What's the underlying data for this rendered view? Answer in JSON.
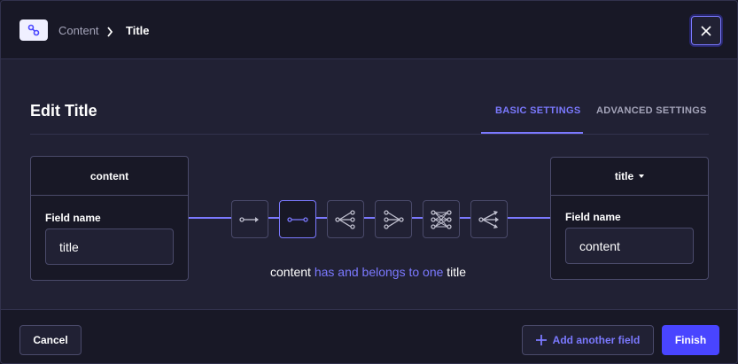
{
  "breadcrumb": {
    "icon": "relation-link-icon",
    "items": [
      "Content",
      "Title"
    ]
  },
  "modal": {
    "title": "Edit Title",
    "close_icon": "close-icon"
  },
  "tabs": [
    {
      "label": "BASIC SETTINGS",
      "active": true
    },
    {
      "label": "ADVANCED SETTINGS",
      "active": false
    }
  ],
  "left_box": {
    "header": "content",
    "field_label": "Field name",
    "field_value": "title"
  },
  "right_box": {
    "header": "title",
    "field_label": "Field name",
    "field_value": "content"
  },
  "relation_types": [
    {
      "icon": "one-way-icon",
      "active": false
    },
    {
      "icon": "one-to-one-icon",
      "active": true
    },
    {
      "icon": "one-to-many-icon",
      "active": false
    },
    {
      "icon": "many-to-one-icon",
      "active": false
    },
    {
      "icon": "many-to-many-icon",
      "active": false
    },
    {
      "icon": "many-ways-icon",
      "active": false
    }
  ],
  "relation_description": {
    "source": "content",
    "verb": "has and belongs to one",
    "target": "title"
  },
  "footer": {
    "cancel_label": "Cancel",
    "add_field_label": "Add another field",
    "finish_label": "Finish"
  },
  "colors": {
    "accent": "#7b79ff",
    "primary_button": "#4945ff",
    "background": "#212134",
    "surface": "#181826",
    "border": "#4a4a6a"
  }
}
